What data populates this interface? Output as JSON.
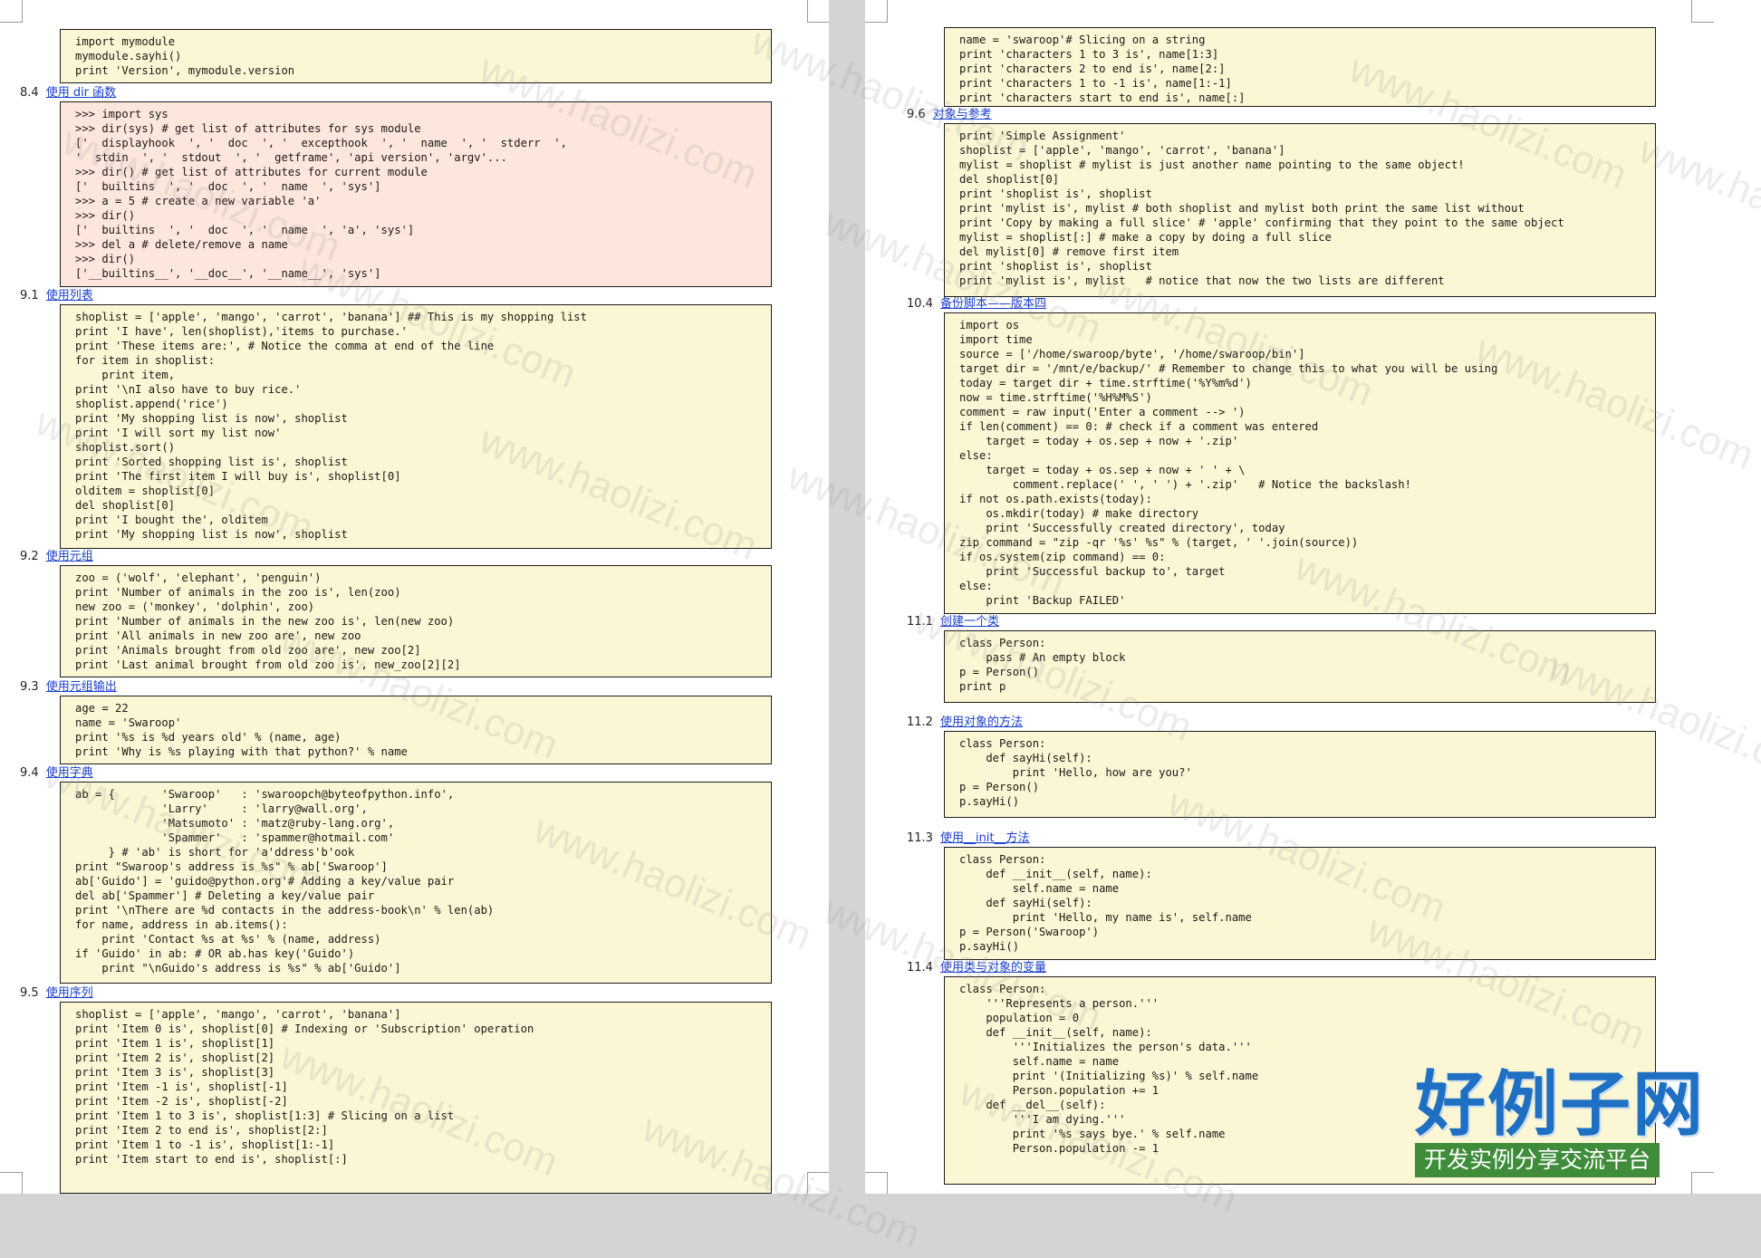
{
  "watermark_text": "www.haolizi.com",
  "logo": {
    "title": "好例子网",
    "subtitle": "开发实例分享交流平台"
  },
  "left": {
    "sections": [
      {
        "num": "",
        "title": "",
        "lines": [
          "import mymodule",
          "mymodule.sayhi()",
          "print 'Version', mymodule.version"
        ]
      },
      {
        "num": "8.4",
        "title": "使用 dir 函数",
        "lines": [
          ">>> import sys",
          ">>> dir(sys) # get list of attributes for sys module",
          "['  displayhook  ', '  doc  ', '  excepthook  ', '  name  ', '  stderr  ',",
          "'  stdin  ', '  stdout  ', '  getframe', 'api version', 'argv'...",
          ">>> dir() # get list of attributes for current module",
          "['  builtins  ', '  doc  ', '  name  ', 'sys']",
          ">>> a = 5 # create a new variable 'a'",
          ">>> dir()",
          "['  builtins  ', '  doc  ', '  name  ', 'a', 'sys']",
          ">>> del a # delete/remove a name",
          ">>> dir()",
          "['__builtins__', '__doc__', '__name__', 'sys']"
        ]
      },
      {
        "num": "9.1",
        "title": "使用列表",
        "lines": [
          "shoplist = ['apple', 'mango', 'carrot', 'banana'] ## This is my shopping list",
          "print 'I have', len(shoplist),'items to purchase.'",
          "print 'These items are:', # Notice the comma at end of the line",
          "for item in shoplist:",
          "    print item,",
          "print '\\nI also have to buy rice.'",
          "shoplist.append('rice')",
          "print 'My shopping list is now', shoplist",
          "print 'I will sort my list now'",
          "shoplist.sort()",
          "print 'Sorted shopping list is', shoplist",
          "print 'The first item I will buy is', shoplist[0]",
          "olditem = shoplist[0]",
          "del shoplist[0]",
          "print 'I bought the', olditem",
          "print 'My shopping list is now', shoplist"
        ]
      },
      {
        "num": "9.2",
        "title": "使用元组",
        "lines": [
          "zoo = ('wolf', 'elephant', 'penguin')",
          "print 'Number of animals in the zoo is', len(zoo)",
          "new zoo = ('monkey', 'dolphin', zoo)",
          "print 'Number of animals in the new zoo is', len(new zoo)",
          "print 'All animals in new zoo are', new zoo",
          "print 'Animals brought from old zoo are', new zoo[2]",
          "print 'Last animal brought from old zoo is', new_zoo[2][2]"
        ]
      },
      {
        "num": "9.3",
        "title": "使用元组输出",
        "lines": [
          "age = 22",
          "name = 'Swaroop'",
          "print '%s is %d years old' % (name, age)",
          "print 'Why is %s playing with that python?' % name"
        ]
      },
      {
        "num": "9.4",
        "title": "使用字典",
        "lines": [
          "ab = {       'Swaroop'   : 'swaroopch@byteofpython.info',",
          "             'Larry'     : 'larry@wall.org',",
          "             'Matsumoto' : 'matz@ruby-lang.org',",
          "             'Spammer'   : 'spammer@hotmail.com'",
          "     } # 'ab' is short for 'a'ddress'b'ook",
          "print \"Swaroop's address is %s\" % ab['Swaroop']",
          "ab['Guido'] = 'guido@python.org'# Adding a key/value pair",
          "del ab['Spammer'] # Deleting a key/value pair",
          "print '\\nThere are %d contacts in the address-book\\n' % len(ab)",
          "for name, address in ab.items():",
          "    print 'Contact %s at %s' % (name, address)",
          "if 'Guido' in ab: # OR ab.has key('Guido')",
          "    print \"\\nGuido's address is %s\" % ab['Guido']"
        ]
      },
      {
        "num": "9.5",
        "title": "使用序列",
        "lines": [
          "shoplist = ['apple', 'mango', 'carrot', 'banana']",
          "print 'Item 0 is', shoplist[0] # Indexing or 'Subscription' operation",
          "print 'Item 1 is', shoplist[1]",
          "print 'Item 2 is', shoplist[2]",
          "print 'Item 3 is', shoplist[3]",
          "print 'Item -1 is', shoplist[-1]",
          "print 'Item -2 is', shoplist[-2]",
          "print 'Item 1 to 3 is', shoplist[1:3] # Slicing on a list",
          "print 'Item 2 to end is', shoplist[2:]",
          "print 'Item 1 to -1 is', shoplist[1:-1]",
          "print 'Item start to end is', shoplist[:]"
        ]
      }
    ]
  },
  "right": {
    "sections": [
      {
        "num": "",
        "title": "",
        "lines": [
          "name = 'swaroop'# Slicing on a string",
          "print 'characters 1 to 3 is', name[1:3]",
          "print 'characters 2 to end is', name[2:]",
          "print 'characters 1 to -1 is', name[1:-1]",
          "print 'characters start to end is', name[:]"
        ]
      },
      {
        "num": "9.6",
        "title": "对象与参考",
        "lines": [
          "print 'Simple Assignment'",
          "shoplist = ['apple', 'mango', 'carrot', 'banana']",
          "mylist = shoplist # mylist is just another name pointing to the same object!",
          "del shoplist[0]",
          "print 'shoplist is', shoplist",
          "print 'mylist is', mylist # both shoplist and mylist both print the same list without",
          "print 'Copy by making a full slice' # 'apple' confirming that they point to the same object",
          "mylist = shoplist[:] # make a copy by doing a full slice",
          "del mylist[0] # remove first item",
          "print 'shoplist is', shoplist",
          "print 'mylist is', mylist   # notice that now the two lists are different"
        ]
      },
      {
        "num": "10.4",
        "title": "备份脚本——版本四",
        "lines": [
          "import os",
          "import time",
          "source = ['/home/swaroop/byte', '/home/swaroop/bin']",
          "target dir = '/mnt/e/backup/' # Remember to change this to what you will be using",
          "today = target dir + time.strftime('%Y%m%d')",
          "now = time.strftime('%H%M%S')",
          "comment = raw input('Enter a comment --> ')",
          "if len(comment) == 0: # check if a comment was entered",
          "    target = today + os.sep + now + '.zip'",
          "else:",
          "    target = today + os.sep + now + ' ' + \\",
          "        comment.replace(' ', ' ') + '.zip'   # Notice the backslash!",
          "if not os.path.exists(today):",
          "    os.mkdir(today) # make directory",
          "    print 'Successfully created directory', today",
          "zip command = \"zip -qr '%s' %s\" % (target, ' '.join(source))",
          "if os.system(zip command) == 0:",
          "    print 'Successful backup to', target",
          "else:",
          "    print 'Backup FAILED'"
        ]
      },
      {
        "num": "11.1",
        "title": "创建一个类",
        "lines": [
          "class Person:",
          "    pass # An empty block",
          "p = Person()",
          "print p"
        ]
      },
      {
        "num": "11.2",
        "title": "使用对象的方法",
        "lines": [
          "class Person:",
          "    def sayHi(self):",
          "        print 'Hello, how are you?'",
          "p = Person()",
          "p.sayHi()"
        ]
      },
      {
        "num": "11.3",
        "title": "使用__init__方法",
        "lines": [
          "class Person:",
          "    def __init__(self, name):",
          "        self.name = name",
          "    def sayHi(self):",
          "        print 'Hello, my name is', self.name",
          "p = Person('Swaroop')",
          "p.sayHi()"
        ]
      },
      {
        "num": "11.4",
        "title": "使用类与对象的变量",
        "lines": [
          "class Person:",
          "    '''Represents a person.'''",
          "    population = 0",
          "    def __init__(self, name):",
          "        '''Initializes the person's data.'''",
          "        self.name = name",
          "        print '(Initializing %s)' % self.name",
          "        Person.population += 1",
          "    def __del__(self):",
          "        '''I am dying.'''",
          "        print '%s says bye.' % self.name",
          "        Person.population -= 1"
        ]
      }
    ]
  }
}
